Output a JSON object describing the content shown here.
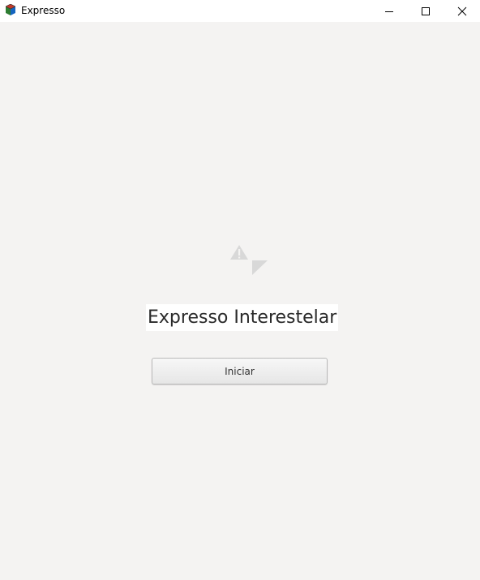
{
  "window": {
    "title": "Expresso",
    "controls": {
      "minimize": "minimize-icon",
      "maximize": "maximize-icon",
      "close": "close-icon"
    }
  },
  "main": {
    "image_icon": "broken-image-icon",
    "headline": "Expresso Interestelar",
    "start_button_label": "Iniciar"
  },
  "colors": {
    "background": "#f4f3f2",
    "titlebar": "#ffffff",
    "button_border": "#b9b9b9"
  }
}
